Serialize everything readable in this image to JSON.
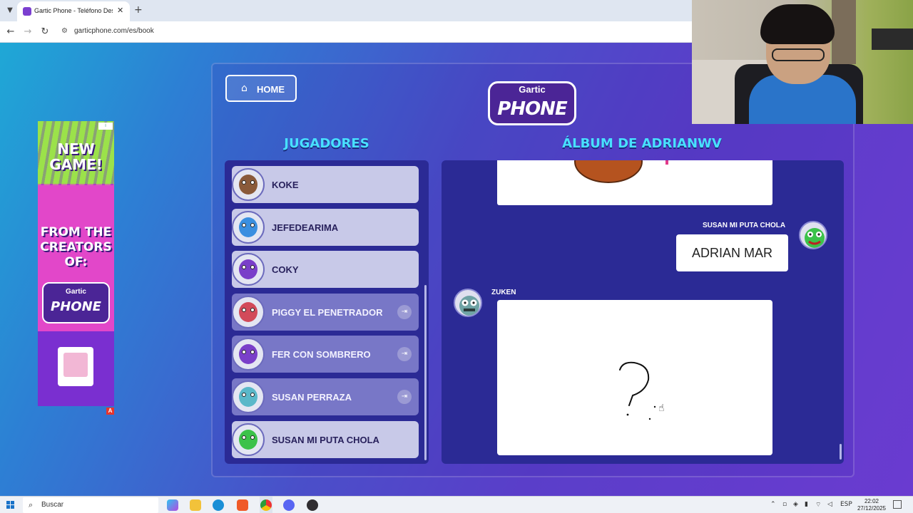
{
  "browser": {
    "tab_title": "Gartic Phone - Teléfono Descon",
    "url": "garticphone.com/es/book",
    "icons": {
      "tab_list": "chevron-down-icon",
      "close": "close-icon",
      "new_tab": "plus-icon",
      "back": "back-arrow-icon",
      "forward": "forward-arrow-icon",
      "reload": "reload-icon",
      "site_info": "site-info-icon"
    }
  },
  "ad": {
    "headline": "NEW GAME!",
    "subline": "FROM THE CREATORS OF:",
    "logo_top": "Gartic",
    "logo_bottom": "PHONE",
    "badge": "A",
    "info": "i"
  },
  "header": {
    "home_label": "HOME",
    "home_icon": "home-icon",
    "logo_top": "Gartic",
    "logo_bottom": "PHONE"
  },
  "players": {
    "title": "JUGADORES",
    "list": [
      {
        "name": "KOKE",
        "active": true,
        "color": "#8a5a3a"
      },
      {
        "name": "JEFEDEARIMA",
        "active": true,
        "color": "#3a8fe0"
      },
      {
        "name": "COKY",
        "active": true,
        "color": "#7a3fc9"
      },
      {
        "name": "PIGGY EL PENETRADOR",
        "active": false,
        "color": "#d24a5a"
      },
      {
        "name": "FER CON SOMBRERO",
        "active": false,
        "color": "#7a3fc9"
      },
      {
        "name": "SUSAN PERRAZA",
        "active": false,
        "color": "#5ab8c9"
      },
      {
        "name": "SUSAN MI PUTA CHOLA",
        "active": true,
        "color": "#3cc24a"
      }
    ]
  },
  "album": {
    "title": "ÁLBUM DE ADRIANWV",
    "entries": [
      {
        "author": "SUSAN MI PUTA CHOLA",
        "text": "ADRIAN MAR"
      },
      {
        "author": "ZUKEN",
        "drawing": "question-mark"
      }
    ]
  },
  "taskbar": {
    "search_label": "Buscar",
    "lang": "ESP",
    "time": "22:02",
    "date": "27/12/2025",
    "apps": [
      "copilot-icon",
      "file-explorer-icon",
      "edge-icon",
      "brave-icon",
      "chrome-icon",
      "discord-icon",
      "obs-icon"
    ]
  }
}
